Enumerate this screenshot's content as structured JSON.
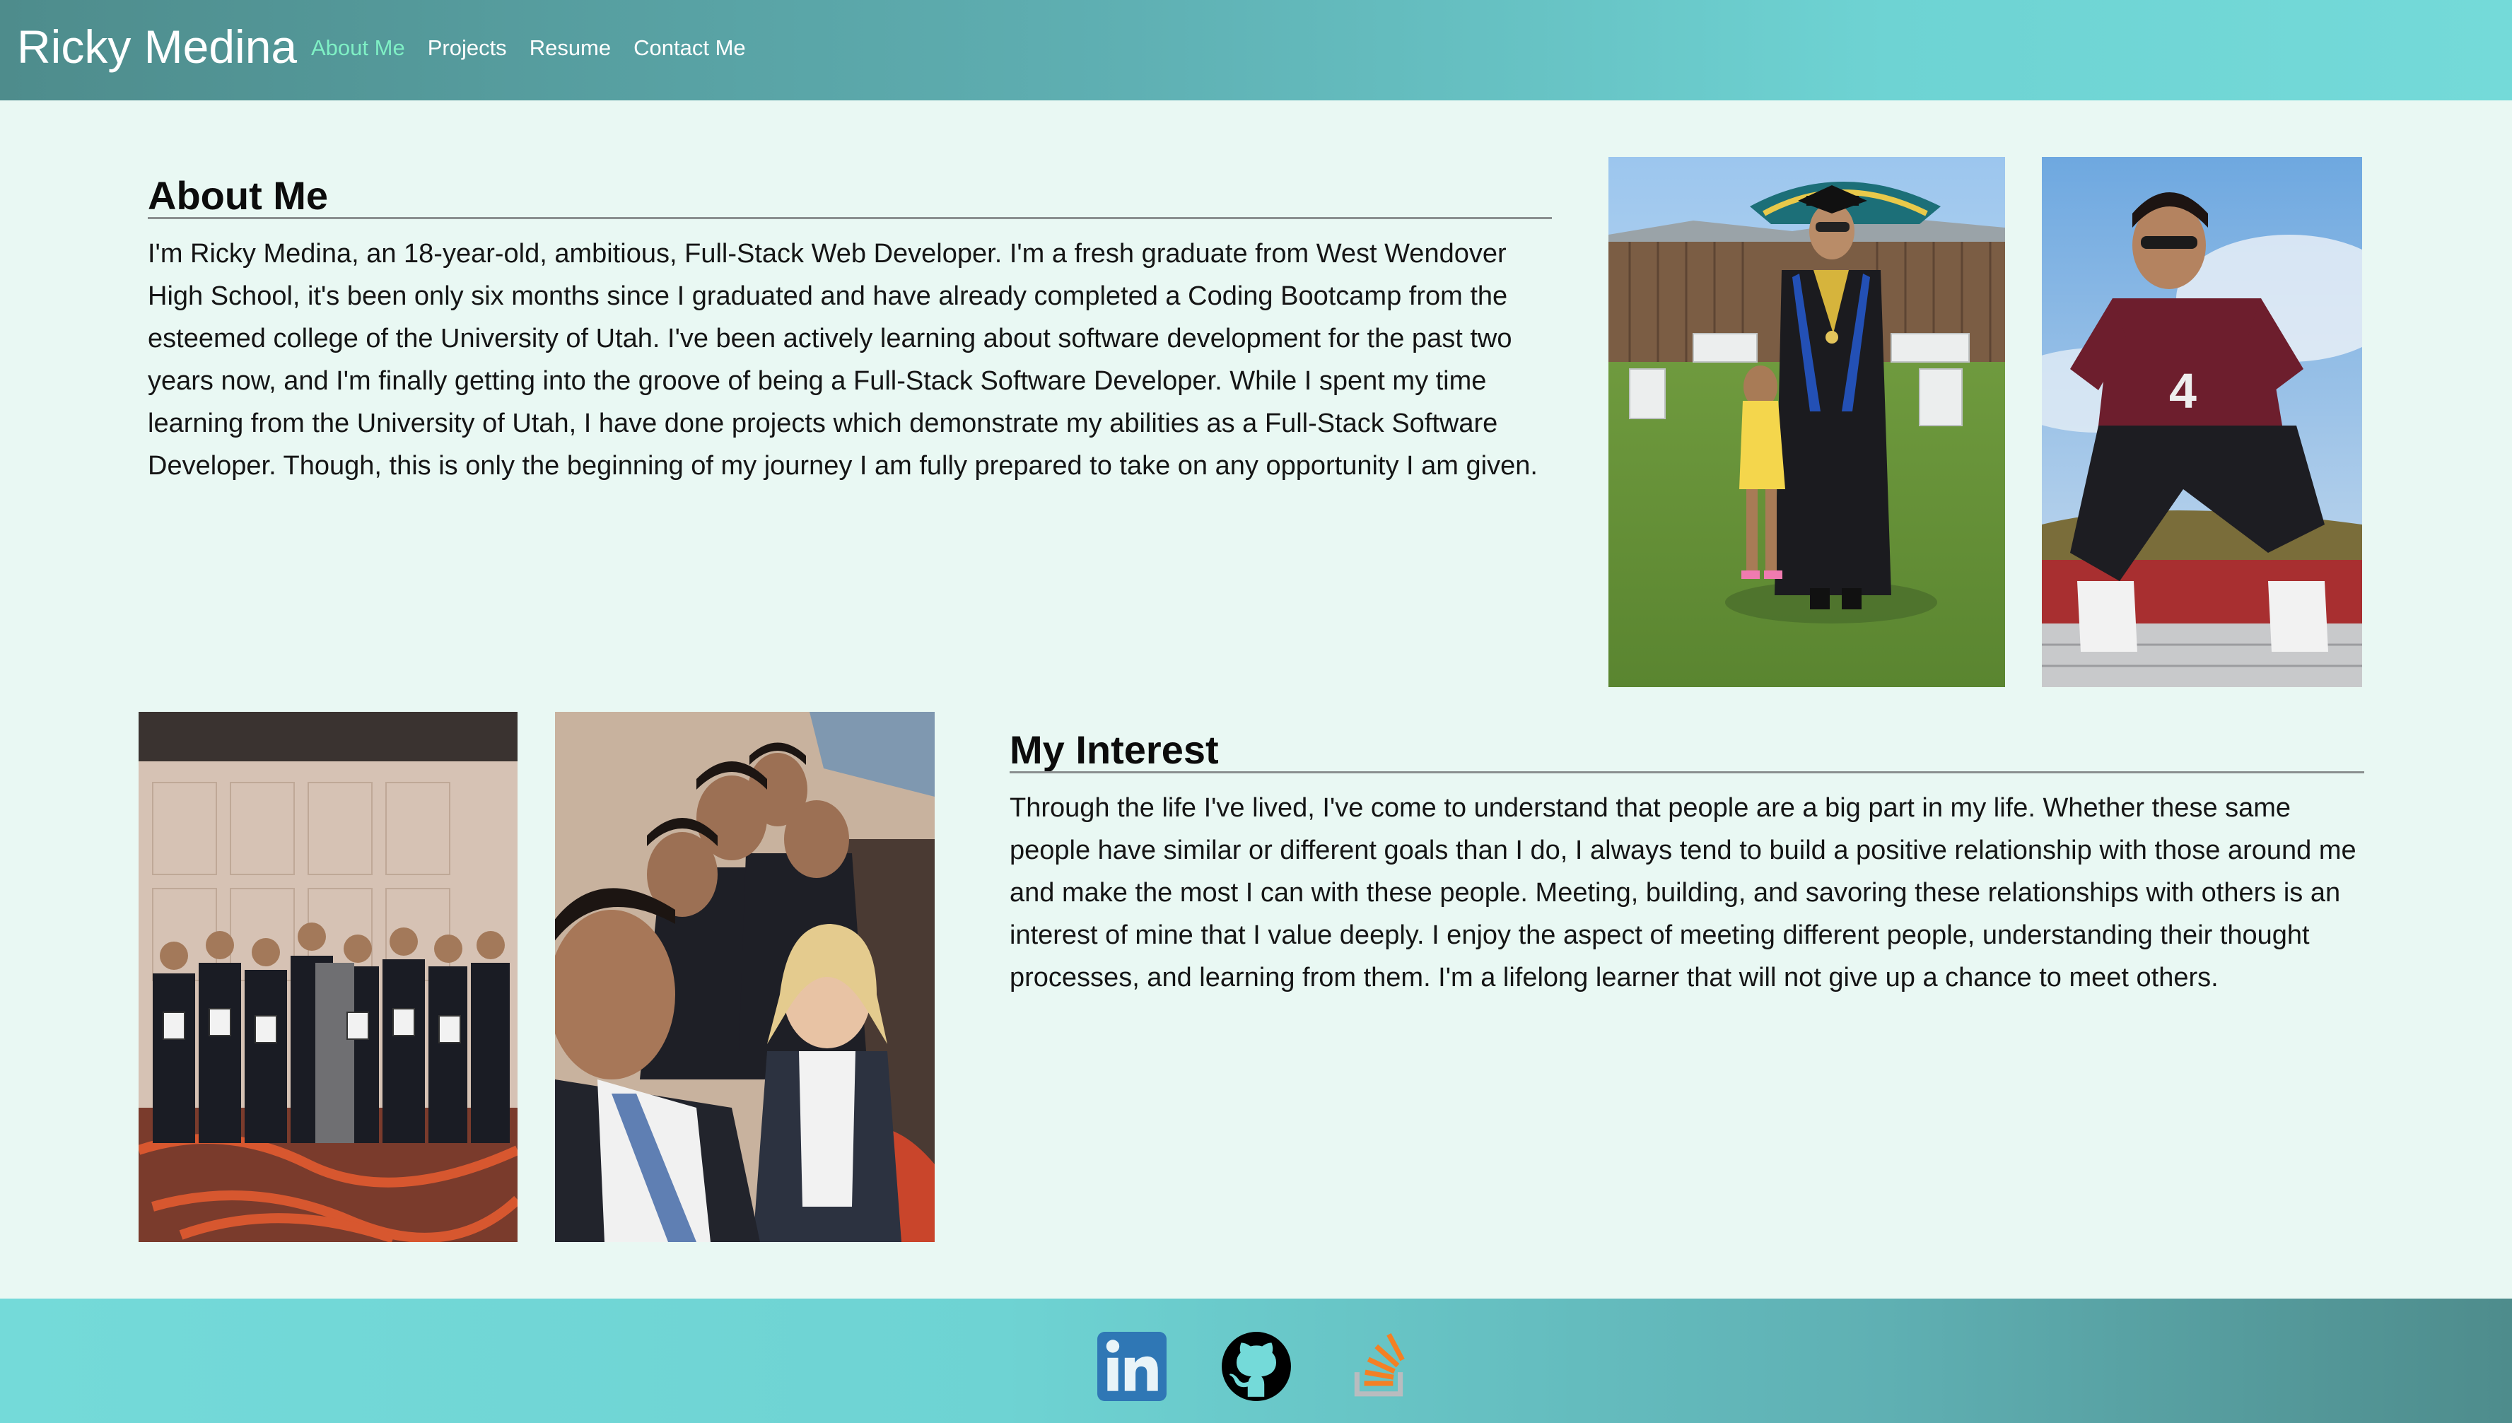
{
  "header": {
    "brand": "Ricky Medina",
    "nav": [
      {
        "label": "About Me",
        "active": true
      },
      {
        "label": "Projects",
        "active": false
      },
      {
        "label": "Resume",
        "active": false
      },
      {
        "label": "Contact Me",
        "active": false
      }
    ]
  },
  "about": {
    "title": "About Me",
    "text": "I'm Ricky Medina, an 18-year-old, ambitious, Full-Stack Web Developer. I'm a fresh graduate from West Wendover High School, it's been only six months since I graduated and have already completed a Coding Bootcamp from the esteemed college of the University of Utah. I've been actively learning about software development for the past two years now, and I'm finally getting into the groove of being a Full-Stack Software Developer. While I spent my time learning from the University of Utah, I have done projects which demonstrate my abilities as a Full-Stack Software Developer. Though, this is only the beginning of my journey I am fully prepared to take on any opportunity I am given."
  },
  "interest": {
    "title": "My Interest",
    "text": "Through the life I've lived, I've come to understand that people are a big part in my life. Whether these same people have similar or different goals than I do, I always tend to build a positive relationship with those around me and make the most I can with these people. Meeting, building, and savoring these relationships with others is an interest of mine that I value deeply. I enjoy the aspect of meeting different people, understanding their thought processes, and learning from them. I'm a lifelong learner that will not give up a chance to meet others."
  },
  "photos": [
    "graduation-photo",
    "soccer-jersey-photo",
    "group-award-photo",
    "group-selfie-photo"
  ],
  "footer": {
    "icons": [
      "linkedin-icon",
      "github-icon",
      "stackoverflow-icon"
    ]
  },
  "colors": {
    "header_start": "#4e8c8c",
    "header_end": "#74dad9",
    "page_bg": "#e9f8f3",
    "nav_active": "#7ff0c5",
    "linkedin": "#2f77b5",
    "stackoverflow": "#f48024"
  }
}
